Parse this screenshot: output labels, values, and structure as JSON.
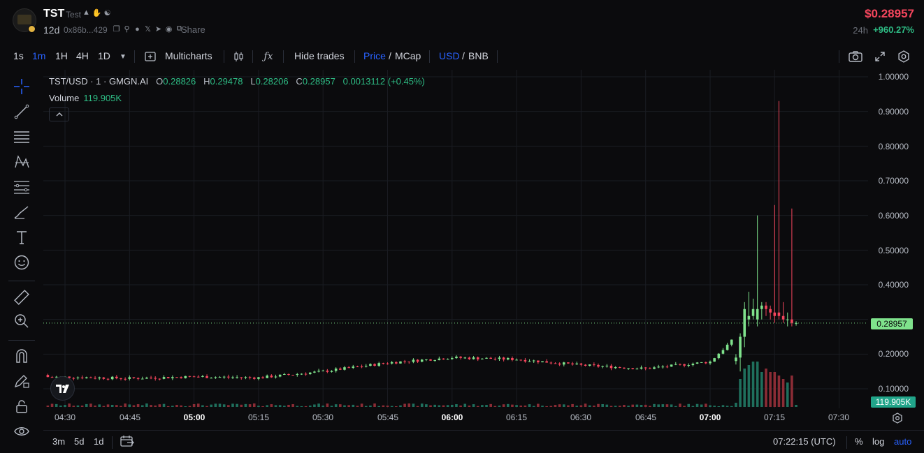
{
  "token": {
    "name": "TST",
    "tag": "Test",
    "age": "12d",
    "address": "0x86b...429",
    "share_label": "Share",
    "price": "$0.28957",
    "change_label": "24h",
    "change": "+960.27%",
    "icon_names": [
      "flame-icon",
      "hand-icon",
      "people-icon"
    ],
    "meta_icon_names": [
      "copy-icon",
      "search-icon",
      "globe-icon",
      "x-icon",
      "telegram-icon",
      "web-icon",
      "share-icon"
    ]
  },
  "toolbar": {
    "intervals": [
      "1s",
      "1m",
      "1H",
      "4H",
      "1D"
    ],
    "active_interval": "1m",
    "multicharts_label": "Multicharts",
    "hide_trades_label": "Hide trades",
    "price_label": "Price",
    "mcap_label": "MCap",
    "slash": "/",
    "usd_label": "USD",
    "bnb_label": "BNB"
  },
  "legend": {
    "symbol": "TST/USD · 1 · GMGN.AI",
    "o_key": "O",
    "o_val": "0.28826",
    "h_key": "H",
    "h_val": "0.29478",
    "l_key": "L",
    "l_val": "0.28206",
    "c_key": "C",
    "c_val": "0.28957",
    "change": "0.0013112 (+0.45%)",
    "volume_label": "Volume",
    "volume_value": "119.905K"
  },
  "price_axis": {
    "labels": [
      "1.00000",
      "0.90000",
      "0.80000",
      "0.70000",
      "0.60000",
      "0.50000",
      "0.40000",
      "0.20000",
      "0.10000"
    ],
    "last_price": "0.28957",
    "volume_tag": "119.905K"
  },
  "time_axis": {
    "labels": [
      "04:30",
      "04:45",
      "05:00",
      "05:15",
      "05:30",
      "05:45",
      "06:00",
      "06:15",
      "06:30",
      "06:45",
      "07:00",
      "07:15",
      "07:30"
    ],
    "bold": [
      "05:00",
      "06:00",
      "07:00"
    ]
  },
  "bottom": {
    "ranges": [
      "3m",
      "5d",
      "1d"
    ],
    "clock": "07:22:15 (UTC)",
    "percent_label": "%",
    "log_label": "log",
    "auto_label": "auto"
  },
  "colors": {
    "up": "#7fe28c",
    "down": "#f6465d",
    "vol_up": "#1f6f5c",
    "vol_down": "#8b2c35",
    "accent": "#2962ff"
  },
  "chart_data": {
    "type": "candlestick",
    "symbol": "TST/USD",
    "interval": "1m",
    "ylim": [
      0.0,
      1.0
    ],
    "price_scale": "linear",
    "last_close": 0.28957,
    "grid": true,
    "series_summary": {
      "note_range_04_30_07_05": "price drifts between ~0.13 and ~0.20",
      "spike_start": "07:06",
      "spike_highs": [
        0.6,
        0.93,
        0.63,
        0.62
      ]
    },
    "key_candles": [
      {
        "time": "04:26",
        "open": 0.14,
        "high": 0.165,
        "low": 0.12,
        "close": 0.135
      },
      {
        "time": "04:45",
        "open": 0.132,
        "high": 0.135,
        "low": 0.128,
        "close": 0.13
      },
      {
        "time": "05:00",
        "open": 0.137,
        "high": 0.14,
        "low": 0.132,
        "close": 0.135
      },
      {
        "time": "05:15",
        "open": 0.13,
        "high": 0.134,
        "low": 0.127,
        "close": 0.132
      },
      {
        "time": "05:30",
        "open": 0.148,
        "high": 0.153,
        "low": 0.143,
        "close": 0.15
      },
      {
        "time": "05:45",
        "open": 0.165,
        "high": 0.18,
        "low": 0.16,
        "close": 0.175
      },
      {
        "time": "06:00",
        "open": 0.18,
        "high": 0.21,
        "low": 0.165,
        "close": 0.19
      },
      {
        "time": "06:15",
        "open": 0.18,
        "high": 0.195,
        "low": 0.165,
        "close": 0.185
      },
      {
        "time": "06:30",
        "open": 0.175,
        "high": 0.185,
        "low": 0.16,
        "close": 0.168
      },
      {
        "time": "06:45",
        "open": 0.155,
        "high": 0.162,
        "low": 0.148,
        "close": 0.158
      },
      {
        "time": "07:00",
        "open": 0.18,
        "high": 0.195,
        "low": 0.17,
        "close": 0.178
      },
      {
        "time": "07:06",
        "open": 0.18,
        "high": 0.26,
        "low": 0.15,
        "close": 0.25
      },
      {
        "time": "07:08",
        "open": 0.25,
        "high": 0.35,
        "low": 0.22,
        "close": 0.33
      },
      {
        "time": "07:11",
        "open": 0.3,
        "high": 0.6,
        "low": 0.28,
        "close": 0.33
      },
      {
        "time": "07:17",
        "open": 0.32,
        "high": 0.93,
        "low": 0.29,
        "close": 0.31
      },
      {
        "time": "07:20",
        "open": 0.3,
        "high": 0.62,
        "low": 0.28,
        "close": 0.29
      },
      {
        "time": "07:22",
        "open": 0.28826,
        "high": 0.29478,
        "low": 0.28206,
        "close": 0.28957
      }
    ],
    "volume": {
      "last": "119.905K",
      "spike_bars": [
        {
          "time": "07:11",
          "direction": "up"
        },
        {
          "time": "07:13",
          "direction": "up"
        },
        {
          "time": "07:15",
          "direction": "down"
        },
        {
          "time": "07:17",
          "direction": "down"
        },
        {
          "time": "07:20",
          "direction": "down"
        }
      ]
    }
  }
}
